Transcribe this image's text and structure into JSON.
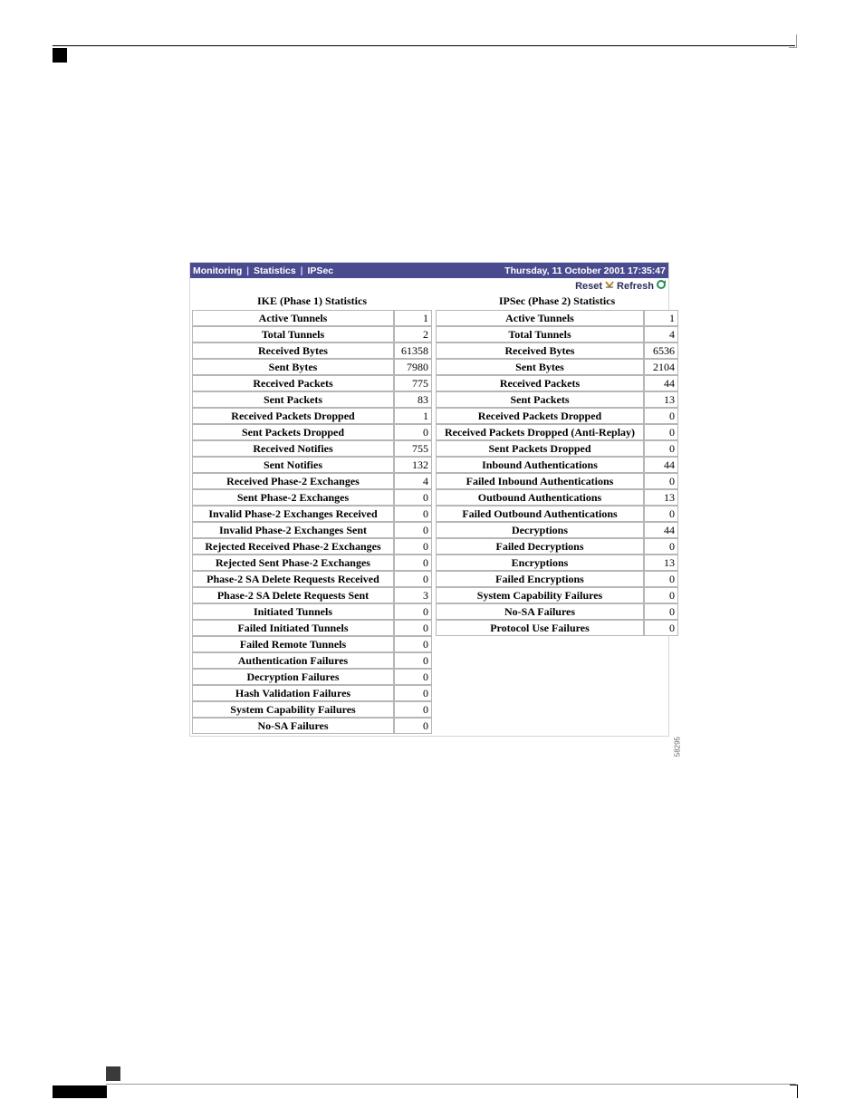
{
  "titlebar": {
    "crumb1": "Monitoring",
    "crumb2": "Statistics",
    "crumb3": "IPSec",
    "datetime": "Thursday, 11 October 2001 17:35:47"
  },
  "toolbar": {
    "reset_label": "Reset",
    "refresh_label": "Refresh"
  },
  "phase1": {
    "title": "IKE (Phase 1) Statistics",
    "rows": [
      {
        "label": "Active Tunnels",
        "value": "1"
      },
      {
        "label": "Total Tunnels",
        "value": "2"
      },
      {
        "label": "Received Bytes",
        "value": "61358"
      },
      {
        "label": "Sent Bytes",
        "value": "7980"
      },
      {
        "label": "Received Packets",
        "value": "775"
      },
      {
        "label": "Sent Packets",
        "value": "83"
      },
      {
        "label": "Received Packets Dropped",
        "value": "1"
      },
      {
        "label": "Sent Packets Dropped",
        "value": "0"
      },
      {
        "label": "Received Notifies",
        "value": "755"
      },
      {
        "label": "Sent Notifies",
        "value": "132"
      },
      {
        "label": "Received Phase-2 Exchanges",
        "value": "4"
      },
      {
        "label": "Sent Phase-2 Exchanges",
        "value": "0"
      },
      {
        "label": "Invalid Phase-2 Exchanges Received",
        "value": "0"
      },
      {
        "label": "Invalid Phase-2 Exchanges Sent",
        "value": "0"
      },
      {
        "label": "Rejected Received Phase-2 Exchanges",
        "value": "0"
      },
      {
        "label": "Rejected Sent Phase-2 Exchanges",
        "value": "0"
      },
      {
        "label": "Phase-2 SA Delete Requests Received",
        "value": "0"
      },
      {
        "label": "Phase-2 SA Delete Requests Sent",
        "value": "3"
      },
      {
        "label": "Initiated Tunnels",
        "value": "0"
      },
      {
        "label": "Failed Initiated Tunnels",
        "value": "0"
      },
      {
        "label": "Failed Remote Tunnels",
        "value": "0"
      },
      {
        "label": "Authentication Failures",
        "value": "0"
      },
      {
        "label": "Decryption Failures",
        "value": "0"
      },
      {
        "label": "Hash Validation Failures",
        "value": "0"
      },
      {
        "label": "System Capability Failures",
        "value": "0"
      },
      {
        "label": "No-SA Failures",
        "value": "0"
      }
    ]
  },
  "phase2": {
    "title": "IPSec (Phase 2) Statistics",
    "rows": [
      {
        "label": "Active Tunnels",
        "value": "1"
      },
      {
        "label": "Total Tunnels",
        "value": "4"
      },
      {
        "label": "Received Bytes",
        "value": "6536"
      },
      {
        "label": "Sent Bytes",
        "value": "2104"
      },
      {
        "label": "Received Packets",
        "value": "44"
      },
      {
        "label": "Sent Packets",
        "value": "13"
      },
      {
        "label": "Received Packets Dropped",
        "value": "0"
      },
      {
        "label": "Received Packets Dropped (Anti-Replay)",
        "value": "0"
      },
      {
        "label": "Sent Packets Dropped",
        "value": "0"
      },
      {
        "label": "Inbound Authentications",
        "value": "44"
      },
      {
        "label": "Failed Inbound Authentications",
        "value": "0"
      },
      {
        "label": "Outbound Authentications",
        "value": "13"
      },
      {
        "label": "Failed Outbound Authentications",
        "value": "0"
      },
      {
        "label": "Decryptions",
        "value": "44"
      },
      {
        "label": "Failed Decryptions",
        "value": "0"
      },
      {
        "label": "Encryptions",
        "value": "13"
      },
      {
        "label": "Failed Encryptions",
        "value": "0"
      },
      {
        "label": "System Capability Failures",
        "value": "0"
      },
      {
        "label": "No-SA Failures",
        "value": "0"
      },
      {
        "label": "Protocol Use Failures",
        "value": "0"
      }
    ]
  },
  "side_id": "58295",
  "layout": {
    "p1_label_w": 215,
    "p1_val_w": 34,
    "p2_label_w": 222,
    "p2_val_w": 30
  }
}
